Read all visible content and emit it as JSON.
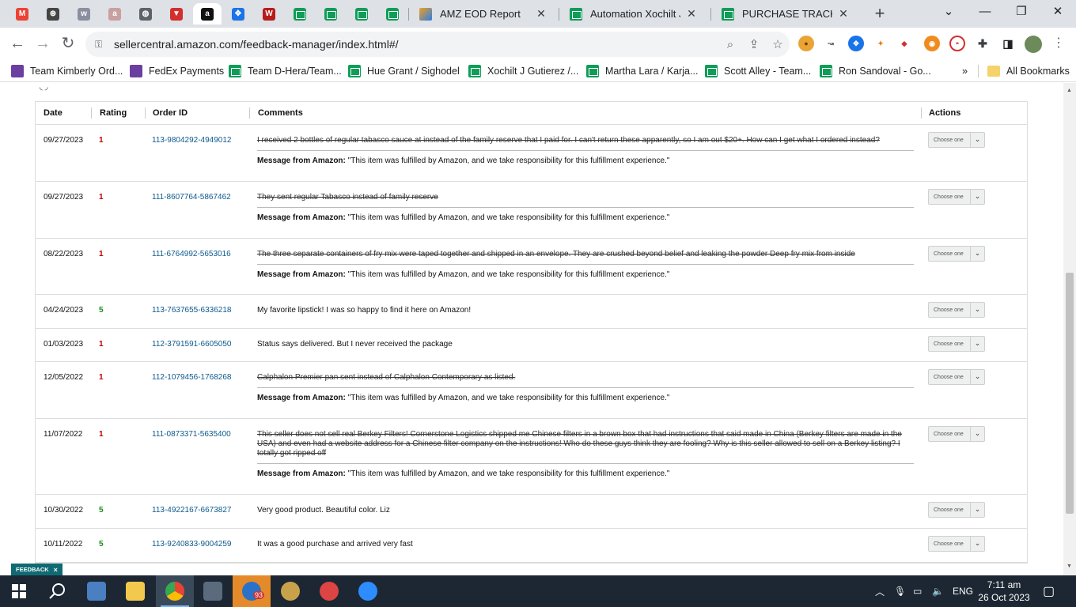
{
  "browser": {
    "pinned_tabs": [
      {
        "icon": "gmail-icon",
        "color": "#ea4335",
        "glyph": "M"
      },
      {
        "icon": "chatgpt-icon",
        "color": "#444444",
        "glyph": "⊛"
      },
      {
        "icon": "app-icon",
        "color": "#8a8fa0",
        "glyph": "w"
      },
      {
        "icon": "app-icon",
        "color": "#c9a0a0",
        "glyph": "a"
      },
      {
        "icon": "globe-icon",
        "color": "#5f6368",
        "glyph": "◍"
      },
      {
        "icon": "vector-icon",
        "color": "#d32f2f",
        "glyph": "▼"
      },
      {
        "icon": "amazon-icon",
        "color": "#111111",
        "glyph": "a"
      },
      {
        "icon": "app-icon",
        "color": "#1a73e8",
        "glyph": "✥"
      },
      {
        "icon": "app-icon",
        "color": "#b71c1c",
        "glyph": "W"
      },
      {
        "icon": "sheets-icon",
        "color": "#0f9d58",
        "glyph": ""
      },
      {
        "icon": "sheets-icon",
        "color": "#0f9d58",
        "glyph": ""
      },
      {
        "icon": "sheets-icon",
        "color": "#0f9d58",
        "glyph": ""
      },
      {
        "icon": "sheets-icon",
        "color": "#0f9d58",
        "glyph": ""
      }
    ],
    "tabs": [
      {
        "title": "AMZ EOD Report",
        "icon": "pen-icon"
      },
      {
        "title": "Automation Xochilt J G",
        "icon": "sheets-icon"
      },
      {
        "title": "PURCHASE TRACKER JU",
        "icon": "sheets-icon"
      }
    ],
    "url": "sellercentral.amazon.com/feedback-manager/index.html#/",
    "bookmarks": [
      {
        "label": "Team Kimberly Ord...",
        "icon": "list-icon"
      },
      {
        "label": "FedEx Payments",
        "icon": "list-icon"
      },
      {
        "label": "Team D-Hera/Team...",
        "icon": "sheets-icon"
      },
      {
        "label": "Hue Grant / Sighodel",
        "icon": "sheets-icon"
      },
      {
        "label": "Xochilt J Gutierez /...",
        "icon": "sheets-icon"
      },
      {
        "label": "Martha Lara / Karja...",
        "icon": "sheets-icon"
      },
      {
        "label": "Scott Alley - Team...",
        "icon": "sheets-icon"
      },
      {
        "label": "Ron Sandoval - Go...",
        "icon": "sheets-icon"
      }
    ],
    "bookmarks_more": "»",
    "all_bookmarks": "All Bookmarks"
  },
  "table": {
    "headers": {
      "date": "Date",
      "rating": "Rating",
      "order_id": "Order ID",
      "comments": "Comments",
      "actions": "Actions"
    },
    "message_label": "Message from Amazon:",
    "message_text": "\"This item was fulfilled by Amazon, and we take responsibility for this fulfillment experience.\"",
    "action_placeholder": "Choose one",
    "rows": [
      {
        "date": "09/27/2023",
        "rating": "1",
        "order": "113-9804292-4949012",
        "comment": "I received 2 bottles of regular tabasco sauce at instead of the family reserve that I paid for. I can't return these apparently, so I am out $20+. How can I get what I ordered instead?",
        "struck": true
      },
      {
        "date": "09/27/2023",
        "rating": "1",
        "order": "111-8607764-5867462",
        "comment": "They sent regular Tabasco instead of family reserve",
        "struck": true
      },
      {
        "date": "08/22/2023",
        "rating": "1",
        "order": "111-6764992-5653016",
        "comment": "The three separate containers of fry mix were taped together and shipped in an envelope. They are crushed beyond belief and leaking the powder Deep fry mix from inside",
        "struck": true
      },
      {
        "date": "04/24/2023",
        "rating": "5",
        "order": "113-7637655-6336218",
        "comment": "My favorite lipstick! I was so happy to find it here on Amazon!",
        "struck": false
      },
      {
        "date": "01/03/2023",
        "rating": "1",
        "order": "112-3791591-6605050",
        "comment": "Status says delivered. But I never received the package",
        "struck": false
      },
      {
        "date": "12/05/2022",
        "rating": "1",
        "order": "112-1079456-1768268",
        "comment": "Calphalon Premier pan sent instead of Calphalon Contemporary as listed.",
        "struck": true
      },
      {
        "date": "11/07/2022",
        "rating": "1",
        "order": "111-0873371-5635400",
        "comment": "This seller does not sell real Berkey Filters! Cornerstone Logistics shipped me Chinese filters in a brown box that had instructions that said made in China (Berkey filters are made in the USA) and even had a website address for a Chinese filter company on the instructions! Who do these guys think they are fooling? Why is this seller allowed to sell on a Berkey listing? I totally got ripped off",
        "struck": true
      },
      {
        "date": "10/30/2022",
        "rating": "5",
        "order": "113-4922167-6673827",
        "comment": "Very good product. Beautiful color. Liz",
        "struck": false
      },
      {
        "date": "10/11/2022",
        "rating": "5",
        "order": "113-9240833-9004259",
        "comment": "It was a good purchase and arrived very fast",
        "struck": false
      }
    ]
  },
  "feedback_tab": {
    "label": "FEEDBACK",
    "close": "×"
  },
  "taskbar": {
    "language": "ENG",
    "time": "7:11 am",
    "date": "26 Oct 2023",
    "badge": "93"
  }
}
